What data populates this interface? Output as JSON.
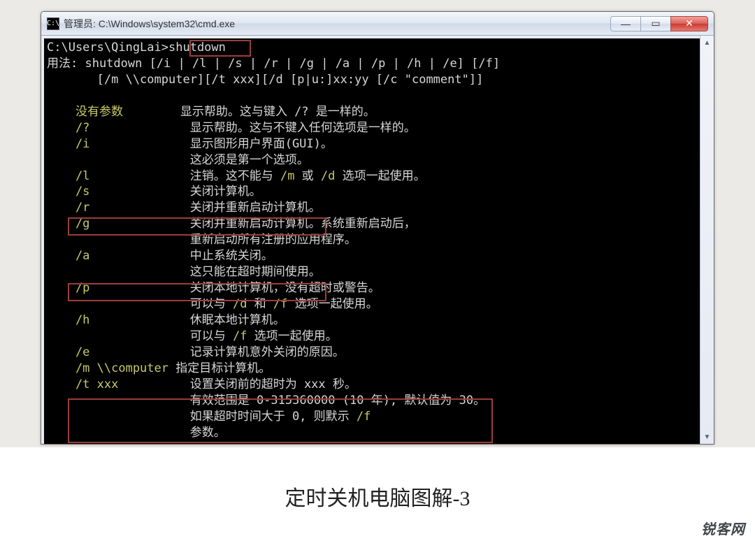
{
  "titlebar": {
    "icon_label": "C:\\",
    "title": "管理员: C:\\Windows\\system32\\cmd.exe",
    "min": "—",
    "max": "▭",
    "close": "✕"
  },
  "scrollbar": {
    "up": "▲",
    "down": "▼"
  },
  "prompt": {
    "path": "C:\\Users\\QingLai>",
    "command": "shutdown"
  },
  "usage": {
    "line1": "用法: shutdown [/i | /l | /s | /r | /g | /a | /p | /h | /e] [/f]",
    "line2": "       [/m \\\\computer][/t xxx][/d [p|u:]xx:yy [/c \"comment\"]]"
  },
  "opts": [
    {
      "flag": "    没有参数",
      "t1": "显示帮助。这与键入 /? 是一样的。"
    },
    {
      "flag": "    /?",
      "t1": "显示帮助。这与不键入任何选项是一样的。"
    },
    {
      "flag": "    /i",
      "t1": "显示图形用户界面(GUI)。",
      "t2": "这必须是第一个选项。"
    },
    {
      "flag": "    /l",
      "t1a": "注销。这不能与 ",
      "tm1": "/m",
      "t1b": " 或 ",
      "tm2": "/d",
      "t1c": " 选项一起使用。"
    },
    {
      "flag": "    /s",
      "t1": "关闭计算机。"
    },
    {
      "flag": "    /r",
      "t1": "关闭并重新启动计算机。"
    },
    {
      "flag": "    /g",
      "t1": "关闭并重新启动计算机。系统重新启动后，",
      "t2": "重新启动所有注册的应用程序。"
    },
    {
      "flag": "    /a",
      "t1": "中止系统关闭。",
      "t2": "这只能在超时期间使用。"
    },
    {
      "flag": "    /p",
      "t1": "关闭本地计算机，没有超时或警告。",
      "t2a": "可以与 ",
      "tm1": "/d",
      "t2b": " 和 ",
      "tm2": "/f",
      "t2c": " 选项一起使用。"
    },
    {
      "flag": "    /h",
      "t1": "休眠本地计算机。",
      "t2a": "可以与 ",
      "tm1": "/f",
      "t2b": " 选项一起使用。"
    },
    {
      "flag": "    /e",
      "t1": "记录计算机意外关闭的原因。"
    },
    {
      "flag": "    /m \\\\computer",
      "t1": "指定目标计算机。",
      "wide": true
    },
    {
      "flag": "    /t xxx",
      "t1": "设置关闭前的超时为 xxx 秒。",
      "t2": "有效范围是 0-315360000 (10 年), 默认值为 30。",
      "t3a": "如果超时时间大于 0, 则默示 ",
      "tm1": "/f",
      "t4": "参数。"
    }
  ],
  "caption": "定时关机电脑图解-3",
  "watermark": "锐客网"
}
